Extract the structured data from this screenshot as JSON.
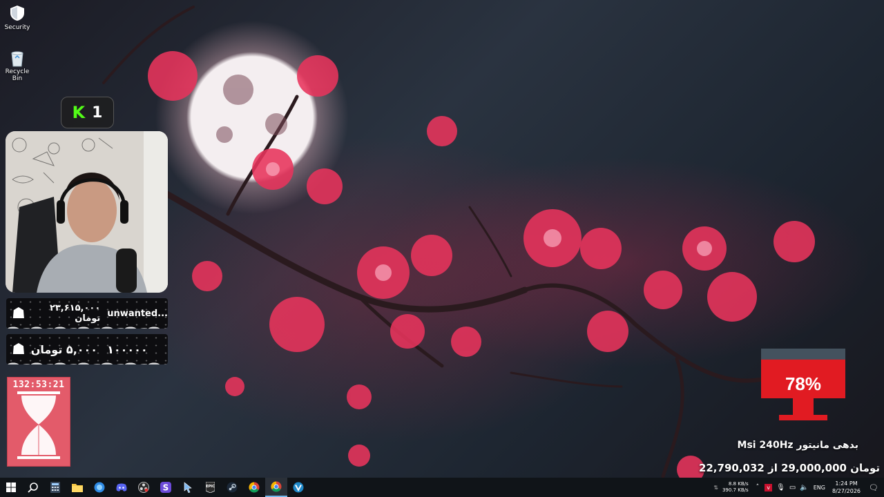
{
  "desktop": {
    "icons": [
      {
        "label": "Security",
        "icon": "shield-icon"
      },
      {
        "label": "Recycle Bin",
        "icon": "recycle-bin-icon"
      }
    ]
  },
  "kick_badge": {
    "letter": "K",
    "count": "1",
    "accent": "#53fc18"
  },
  "donations": [
    {
      "name": "unwanted...",
      "amount": "۲۳,۶۱۵,۰۰۰ تومان"
    },
    {
      "name": "۱۰۰۰۰۰",
      "amount": "۵,۰۰۰ تومان"
    }
  ],
  "timer": {
    "time": "132:53:21"
  },
  "goal": {
    "percent": "78%",
    "percent_value": 78,
    "title": "Msi 240Hz بدهی مانیتور",
    "current": "22,790,032",
    "separator": "از",
    "target": "29,000,000",
    "currency": "تومان",
    "accent": "#e11b22"
  },
  "taskbar": {
    "apps": [
      {
        "name": "start",
        "icon": "windows-start-icon"
      },
      {
        "name": "search",
        "icon": "search-icon"
      },
      {
        "name": "calculator",
        "icon": "calculator-icon"
      },
      {
        "name": "file-explorer",
        "icon": "folder-icon"
      },
      {
        "name": "edge-app",
        "icon": "blue-app-icon"
      },
      {
        "name": "discord",
        "icon": "discord-icon"
      },
      {
        "name": "obs",
        "icon": "obs-icon"
      },
      {
        "name": "skype",
        "icon": "s-app-icon"
      },
      {
        "name": "cursor-tool",
        "icon": "cursor-icon"
      },
      {
        "name": "epic-games",
        "icon": "epic-games-icon"
      },
      {
        "name": "steam",
        "icon": "steam-icon"
      },
      {
        "name": "chrome",
        "icon": "chrome-icon"
      },
      {
        "name": "chrome-2",
        "icon": "chrome-icon"
      },
      {
        "name": "v-app",
        "icon": "v-app-icon"
      }
    ],
    "tray": {
      "upload": "8.8 KB/s",
      "download": "390.7 KB/s",
      "language": "ENG",
      "time": "1:24 PM",
      "date": "8/27/2026"
    }
  }
}
